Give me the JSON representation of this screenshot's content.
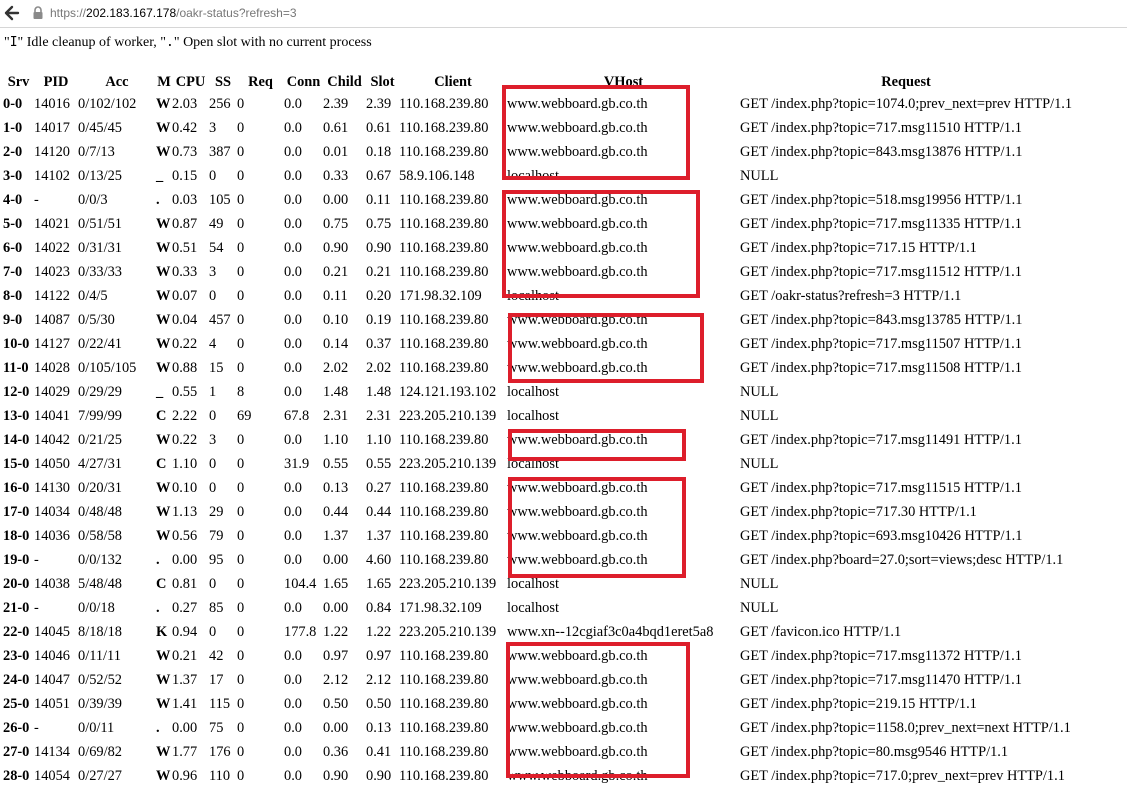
{
  "browser": {
    "url_scheme": "https://",
    "url_host": "202.183.167.178",
    "url_path": "/oakr-status?refresh=3",
    "back_icon": "back-arrow-icon",
    "lock_icon": "lock-icon"
  },
  "legend": {
    "quote1": "\"",
    "code1": "I",
    "text1": "\" Idle cleanup of worker, \"",
    "code2": ".",
    "text2": "\" Open slot with no current process"
  },
  "colors": {
    "annotation": "#dd1e2b"
  },
  "table": {
    "headers": [
      "Srv",
      "PID",
      "Acc",
      "M",
      "CPU",
      "SS",
      "Req",
      "Conn",
      "Child",
      "Slot",
      "Client",
      "VHost",
      "Request"
    ],
    "rows": [
      [
        "0-0",
        "14016",
        "0/102/102",
        "W",
        "2.03",
        "256",
        "0",
        "0.0",
        "2.39",
        "2.39",
        "110.168.239.80",
        "www.webboard.gb.co.th",
        "GET /index.php?topic=1074.0;prev_next=prev HTTP/1.1"
      ],
      [
        "1-0",
        "14017",
        "0/45/45",
        "W",
        "0.42",
        "3",
        "0",
        "0.0",
        "0.61",
        "0.61",
        "110.168.239.80",
        "www.webboard.gb.co.th",
        "GET /index.php?topic=717.msg11510 HTTP/1.1"
      ],
      [
        "2-0",
        "14120",
        "0/7/13",
        "W",
        "0.73",
        "387",
        "0",
        "0.0",
        "0.01",
        "0.18",
        "110.168.239.80",
        "www.webboard.gb.co.th",
        "GET /index.php?topic=843.msg13876 HTTP/1.1"
      ],
      [
        "3-0",
        "14102",
        "0/13/25",
        "_",
        "0.15",
        "0",
        "0",
        "0.0",
        "0.33",
        "0.67",
        "58.9.106.148",
        "localhost",
        "NULL"
      ],
      [
        "4-0",
        "-",
        "0/0/3",
        ".",
        "0.03",
        "105",
        "0",
        "0.0",
        "0.00",
        "0.11",
        "110.168.239.80",
        "www.webboard.gb.co.th",
        "GET /index.php?topic=518.msg19956 HTTP/1.1"
      ],
      [
        "5-0",
        "14021",
        "0/51/51",
        "W",
        "0.87",
        "49",
        "0",
        "0.0",
        "0.75",
        "0.75",
        "110.168.239.80",
        "www.webboard.gb.co.th",
        "GET /index.php?topic=717.msg11335 HTTP/1.1"
      ],
      [
        "6-0",
        "14022",
        "0/31/31",
        "W",
        "0.51",
        "54",
        "0",
        "0.0",
        "0.90",
        "0.90",
        "110.168.239.80",
        "www.webboard.gb.co.th",
        "GET /index.php?topic=717.15 HTTP/1.1"
      ],
      [
        "7-0",
        "14023",
        "0/33/33",
        "W",
        "0.33",
        "3",
        "0",
        "0.0",
        "0.21",
        "0.21",
        "110.168.239.80",
        "www.webboard.gb.co.th",
        "GET /index.php?topic=717.msg11512 HTTP/1.1"
      ],
      [
        "8-0",
        "14122",
        "0/4/5",
        "W",
        "0.07",
        "0",
        "0",
        "0.0",
        "0.11",
        "0.20",
        "171.98.32.109",
        "localhost",
        "GET /oakr-status?refresh=3 HTTP/1.1"
      ],
      [
        "9-0",
        "14087",
        "0/5/30",
        "W",
        "0.04",
        "457",
        "0",
        "0.0",
        "0.10",
        "0.19",
        "110.168.239.80",
        "www.webboard.gb.co.th",
        "GET /index.php?topic=843.msg13785 HTTP/1.1"
      ],
      [
        "10-0",
        "14127",
        "0/22/41",
        "W",
        "0.22",
        "4",
        "0",
        "0.0",
        "0.14",
        "0.37",
        "110.168.239.80",
        "www.webboard.gb.co.th",
        "GET /index.php?topic=717.msg11507 HTTP/1.1"
      ],
      [
        "11-0",
        "14028",
        "0/105/105",
        "W",
        "0.88",
        "15",
        "0",
        "0.0",
        "2.02",
        "2.02",
        "110.168.239.80",
        "www.webboard.gb.co.th",
        "GET /index.php?topic=717.msg11508 HTTP/1.1"
      ],
      [
        "12-0",
        "14029",
        "0/29/29",
        "_",
        "0.55",
        "1",
        "8",
        "0.0",
        "1.48",
        "1.48",
        "124.121.193.102",
        "localhost",
        "NULL"
      ],
      [
        "13-0",
        "14041",
        "7/99/99",
        "C",
        "2.22",
        "0",
        "69",
        "67.8",
        "2.31",
        "2.31",
        "223.205.210.139",
        "localhost",
        "NULL"
      ],
      [
        "14-0",
        "14042",
        "0/21/25",
        "W",
        "0.22",
        "3",
        "0",
        "0.0",
        "1.10",
        "1.10",
        "110.168.239.80",
        "www.webboard.gb.co.th",
        "GET /index.php?topic=717.msg11491 HTTP/1.1"
      ],
      [
        "15-0",
        "14050",
        "4/27/31",
        "C",
        "1.10",
        "0",
        "0",
        "31.9",
        "0.55",
        "0.55",
        "223.205.210.139",
        "localhost",
        "NULL"
      ],
      [
        "16-0",
        "14130",
        "0/20/31",
        "W",
        "0.10",
        "0",
        "0",
        "0.0",
        "0.13",
        "0.27",
        "110.168.239.80",
        "www.webboard.gb.co.th",
        "GET /index.php?topic=717.msg11515 HTTP/1.1"
      ],
      [
        "17-0",
        "14034",
        "0/48/48",
        "W",
        "1.13",
        "29",
        "0",
        "0.0",
        "0.44",
        "0.44",
        "110.168.239.80",
        "www.webboard.gb.co.th",
        "GET /index.php?topic=717.30 HTTP/1.1"
      ],
      [
        "18-0",
        "14036",
        "0/58/58",
        "W",
        "0.56",
        "79",
        "0",
        "0.0",
        "1.37",
        "1.37",
        "110.168.239.80",
        "www.webboard.gb.co.th",
        "GET /index.php?topic=693.msg10426 HTTP/1.1"
      ],
      [
        "19-0",
        "-",
        "0/0/132",
        ".",
        "0.00",
        "95",
        "0",
        "0.0",
        "0.00",
        "4.60",
        "110.168.239.80",
        "www.webboard.gb.co.th",
        "GET /index.php?board=27.0;sort=views;desc HTTP/1.1"
      ],
      [
        "20-0",
        "14038",
        "5/48/48",
        "C",
        "0.81",
        "0",
        "0",
        "104.4",
        "1.65",
        "1.65",
        "223.205.210.139",
        "localhost",
        "NULL"
      ],
      [
        "21-0",
        "-",
        "0/0/18",
        ".",
        "0.27",
        "85",
        "0",
        "0.0",
        "0.00",
        "0.84",
        "171.98.32.109",
        "localhost",
        "NULL"
      ],
      [
        "22-0",
        "14045",
        "8/18/18",
        "K",
        "0.94",
        "0",
        "0",
        "177.8",
        "1.22",
        "1.22",
        "223.205.210.139",
        "www.xn--12cgiaf3c0a4bqd1eret5a8",
        "GET /favicon.ico HTTP/1.1"
      ],
      [
        "23-0",
        "14046",
        "0/11/11",
        "W",
        "0.21",
        "42",
        "0",
        "0.0",
        "0.97",
        "0.97",
        "110.168.239.80",
        "www.webboard.gb.co.th",
        "GET /index.php?topic=717.msg11372 HTTP/1.1"
      ],
      [
        "24-0",
        "14047",
        "0/52/52",
        "W",
        "1.37",
        "17",
        "0",
        "0.0",
        "2.12",
        "2.12",
        "110.168.239.80",
        "www.webboard.gb.co.th",
        "GET /index.php?topic=717.msg11470 HTTP/1.1"
      ],
      [
        "25-0",
        "14051",
        "0/39/39",
        "W",
        "1.41",
        "115",
        "0",
        "0.0",
        "0.50",
        "0.50",
        "110.168.239.80",
        "www.webboard.gb.co.th",
        "GET /index.php?topic=219.15 HTTP/1.1"
      ],
      [
        "26-0",
        "-",
        "0/0/11",
        ".",
        "0.00",
        "75",
        "0",
        "0.0",
        "0.00",
        "0.13",
        "110.168.239.80",
        "www.webboard.gb.co.th",
        "GET /index.php?topic=1158.0;prev_next=next HTTP/1.1"
      ],
      [
        "27-0",
        "14134",
        "0/69/82",
        "W",
        "1.77",
        "176",
        "0",
        "0.0",
        "0.36",
        "0.41",
        "110.168.239.80",
        "www.webboard.gb.co.th",
        "GET /index.php?topic=80.msg9546 HTTP/1.1"
      ],
      [
        "28-0",
        "14054",
        "0/27/27",
        "W",
        "0.96",
        "110",
        "0",
        "0.0",
        "0.90",
        "0.90",
        "110.168.239.80",
        "www.webboard.gb.co.th",
        "GET /index.php?topic=717.0;prev_next=prev HTTP/1.1"
      ]
    ]
  }
}
